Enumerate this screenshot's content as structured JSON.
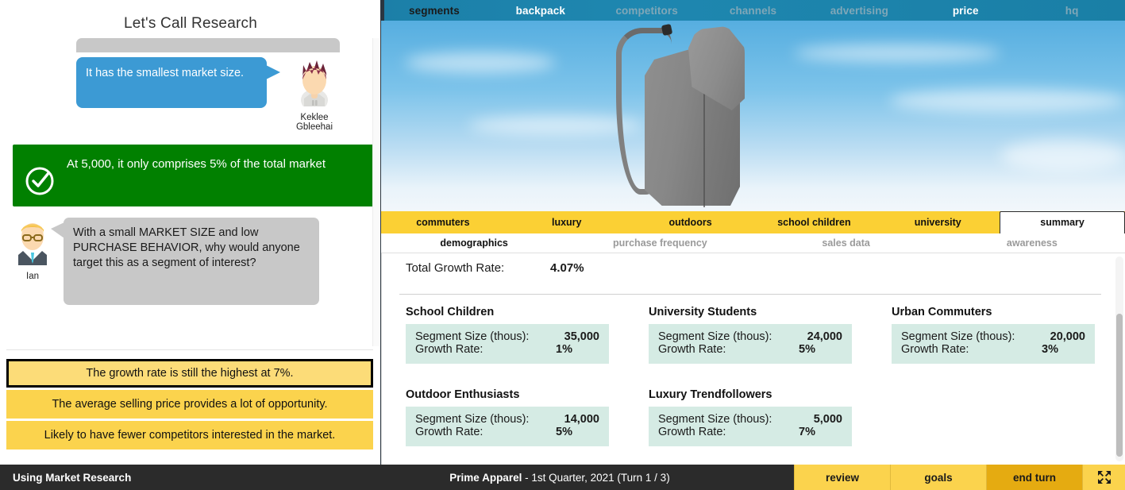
{
  "coach": {
    "title": "Let's Call Research",
    "messages": [
      {
        "speaker": "Keklee Gbleehai",
        "text": "It has the smallest market size.",
        "type": "peer"
      },
      {
        "speaker": "Ian",
        "text": "With a small MARKET SIZE and low PURCHASE BEHAVIOR, why would anyone target this as a segment of interest?",
        "type": "mentor"
      }
    ],
    "callout": {
      "icon": "check-circle-icon",
      "text": "At 5,000, it only comprises 5% of the total market",
      "color": "#018000"
    },
    "choices": [
      {
        "label": "The growth rate is still the highest at 7%.",
        "selected": true
      },
      {
        "label": "The average selling price provides a lot of opportunity.",
        "selected": false
      },
      {
        "label": "Likely to have fewer competitors interested in the market.",
        "selected": false
      }
    ]
  },
  "top_nav": {
    "items": [
      {
        "label": "segments",
        "state": "dark"
      },
      {
        "label": "backpack",
        "state": "active"
      },
      {
        "label": "competitors",
        "state": "muted"
      },
      {
        "label": "channels",
        "state": "muted"
      },
      {
        "label": "advertising",
        "state": "muted"
      },
      {
        "label": "price",
        "state": "active"
      },
      {
        "label": "hq",
        "state": "muted"
      }
    ]
  },
  "hero": {
    "product": "backpack-image",
    "alt": "gray backpack on blue sky"
  },
  "segment_tabs": [
    {
      "label": "commuters",
      "active": false
    },
    {
      "label": "luxury",
      "active": false
    },
    {
      "label": "outdoors",
      "active": false
    },
    {
      "label": "school children",
      "active": false
    },
    {
      "label": "university",
      "active": false
    },
    {
      "label": "summary",
      "active": true
    }
  ],
  "sub_tabs": [
    {
      "label": "demographics",
      "active": true
    },
    {
      "label": "purchase frequency",
      "active": false
    },
    {
      "label": "sales data",
      "active": false
    },
    {
      "label": "awareness",
      "active": false
    }
  ],
  "summary": {
    "total_growth_label": "Total Growth Rate:",
    "total_growth_value": "4.07%",
    "size_label": "Segment Size (thous):",
    "growth_label": "Growth Rate:",
    "segments": [
      {
        "name": "School Children",
        "size": "35,000",
        "growth": "1%"
      },
      {
        "name": "University Students",
        "size": "24,000",
        "growth": "5%"
      },
      {
        "name": "Urban Commuters",
        "size": "20,000",
        "growth": "3%"
      },
      {
        "name": "Outdoor Enthusiasts",
        "size": "14,000",
        "growth": "5%"
      },
      {
        "name": "Luxury Trendfollowers",
        "size": "5,000",
        "growth": "7%"
      }
    ]
  },
  "bottom_bar": {
    "activity": "Using Market Research",
    "company": "Prime Apparel",
    "period": "- 1st Quarter, 2021 (Turn 1 / 3)",
    "buttons": [
      {
        "label": "review",
        "primary": false
      },
      {
        "label": "goals",
        "primary": false
      },
      {
        "label": "end turn",
        "primary": true
      }
    ],
    "fullscreen_icon": "expand-arrows-icon"
  },
  "colors": {
    "accent_yellow": "#fbd34d",
    "tab_yellow": "#fbd034",
    "end_turn": "#e5ab11",
    "nav_teal": "#1e87b0",
    "success_green": "#018000",
    "bubble_blue": "#3c9ad4",
    "bubble_gray": "#c8c8c8",
    "card_mint": "#d5ebe4",
    "bar_dark": "#2b2b2b"
  }
}
